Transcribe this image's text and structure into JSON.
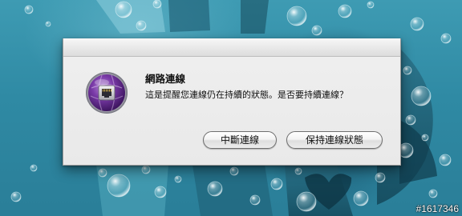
{
  "dialog": {
    "title": "網路連線",
    "message": "這是提醒您連線仍在持續的狀態。是否要持續連線？",
    "icon": "network-connection-icon",
    "buttons": {
      "disconnect_label": "中斷連線",
      "keep_label": "保持連線狀態"
    }
  },
  "watermark": {
    "text": "#1617346"
  },
  "colors": {
    "desktop": "#3196ae",
    "dialog_bg": "#ececec",
    "icon_purple": "#6a2c9a"
  }
}
